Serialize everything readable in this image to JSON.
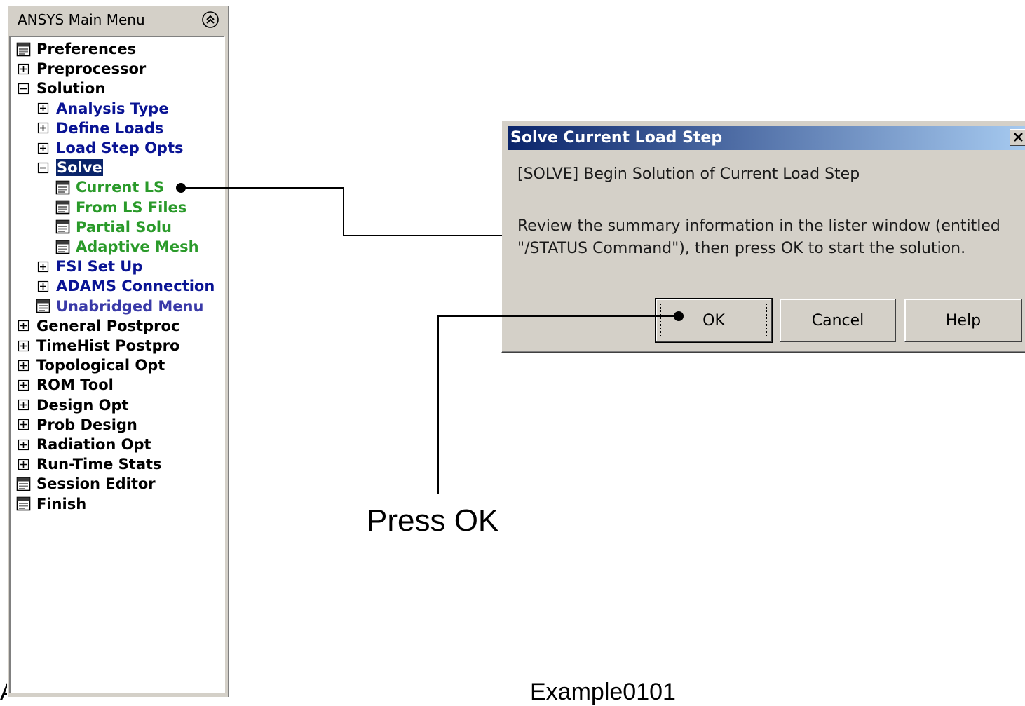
{
  "main_menu": {
    "title": "ANSYS Main Menu",
    "collapse_icon": "double-chevron-up-icon",
    "items": [
      {
        "label": "Preferences",
        "icon": "form-icon",
        "color": "black"
      },
      {
        "label": "Preprocessor",
        "icon": "plus-box-icon",
        "color": "black"
      },
      {
        "label": "Solution",
        "icon": "minus-box-icon",
        "color": "black"
      },
      {
        "label": "Analysis Type",
        "icon": "plus-box-icon",
        "color": "blue"
      },
      {
        "label": "Define Loads",
        "icon": "plus-box-icon",
        "color": "blue"
      },
      {
        "label": "Load Step Opts",
        "icon": "plus-box-icon",
        "color": "blue"
      },
      {
        "label": "Solve",
        "icon": "minus-box-icon",
        "color": "selected"
      },
      {
        "label": "Current LS",
        "icon": "form-icon",
        "color": "green"
      },
      {
        "label": "From LS Files",
        "icon": "form-icon",
        "color": "green"
      },
      {
        "label": "Partial Solu",
        "icon": "form-icon",
        "color": "green"
      },
      {
        "label": "Adaptive Mesh",
        "icon": "form-icon",
        "color": "green"
      },
      {
        "label": "FSI Set Up",
        "icon": "plus-box-icon",
        "color": "blue"
      },
      {
        "label": "ADAMS Connection",
        "icon": "plus-box-icon",
        "color": "blue"
      },
      {
        "label": "Unabridged Menu",
        "icon": "form-icon",
        "color": "violet"
      },
      {
        "label": "General Postproc",
        "icon": "plus-box-icon",
        "color": "black"
      },
      {
        "label": "TimeHist Postpro",
        "icon": "plus-box-icon",
        "color": "black"
      },
      {
        "label": "Topological Opt",
        "icon": "plus-box-icon",
        "color": "black"
      },
      {
        "label": "ROM Tool",
        "icon": "plus-box-icon",
        "color": "black"
      },
      {
        "label": "Design Opt",
        "icon": "plus-box-icon",
        "color": "black"
      },
      {
        "label": "Prob Design",
        "icon": "plus-box-icon",
        "color": "black"
      },
      {
        "label": "Radiation Opt",
        "icon": "plus-box-icon",
        "color": "black"
      },
      {
        "label": "Run-Time Stats",
        "icon": "plus-box-icon",
        "color": "black"
      },
      {
        "label": "Session Editor",
        "icon": "form-icon",
        "color": "black"
      },
      {
        "label": "Finish",
        "icon": "form-icon",
        "color": "black"
      }
    ]
  },
  "dialog": {
    "title": "Solve Current Load Step",
    "close_icon": "close-icon",
    "heading": "[SOLVE] Begin Solution of Current Load Step",
    "message_line1": "Review the summary information in the lister window (entitled",
    "message_line2": "\"/STATUS Command\"), then press OK to start the solution.",
    "buttons": {
      "ok": "OK",
      "cancel": "Cancel",
      "help": "Help"
    }
  },
  "annotations": {
    "press_ok": "Press OK",
    "footer": "Example0101",
    "footer_left": "A"
  },
  "colors": {
    "panel_bg": "#d4d0c8",
    "titlebar_start": "#0a246a",
    "titlebar_end": "#a6caf0",
    "selection": "#0a246a",
    "menu_blue": "#0a1494",
    "menu_green": "#2a9a2a",
    "menu_violet": "#3a3aa8"
  }
}
